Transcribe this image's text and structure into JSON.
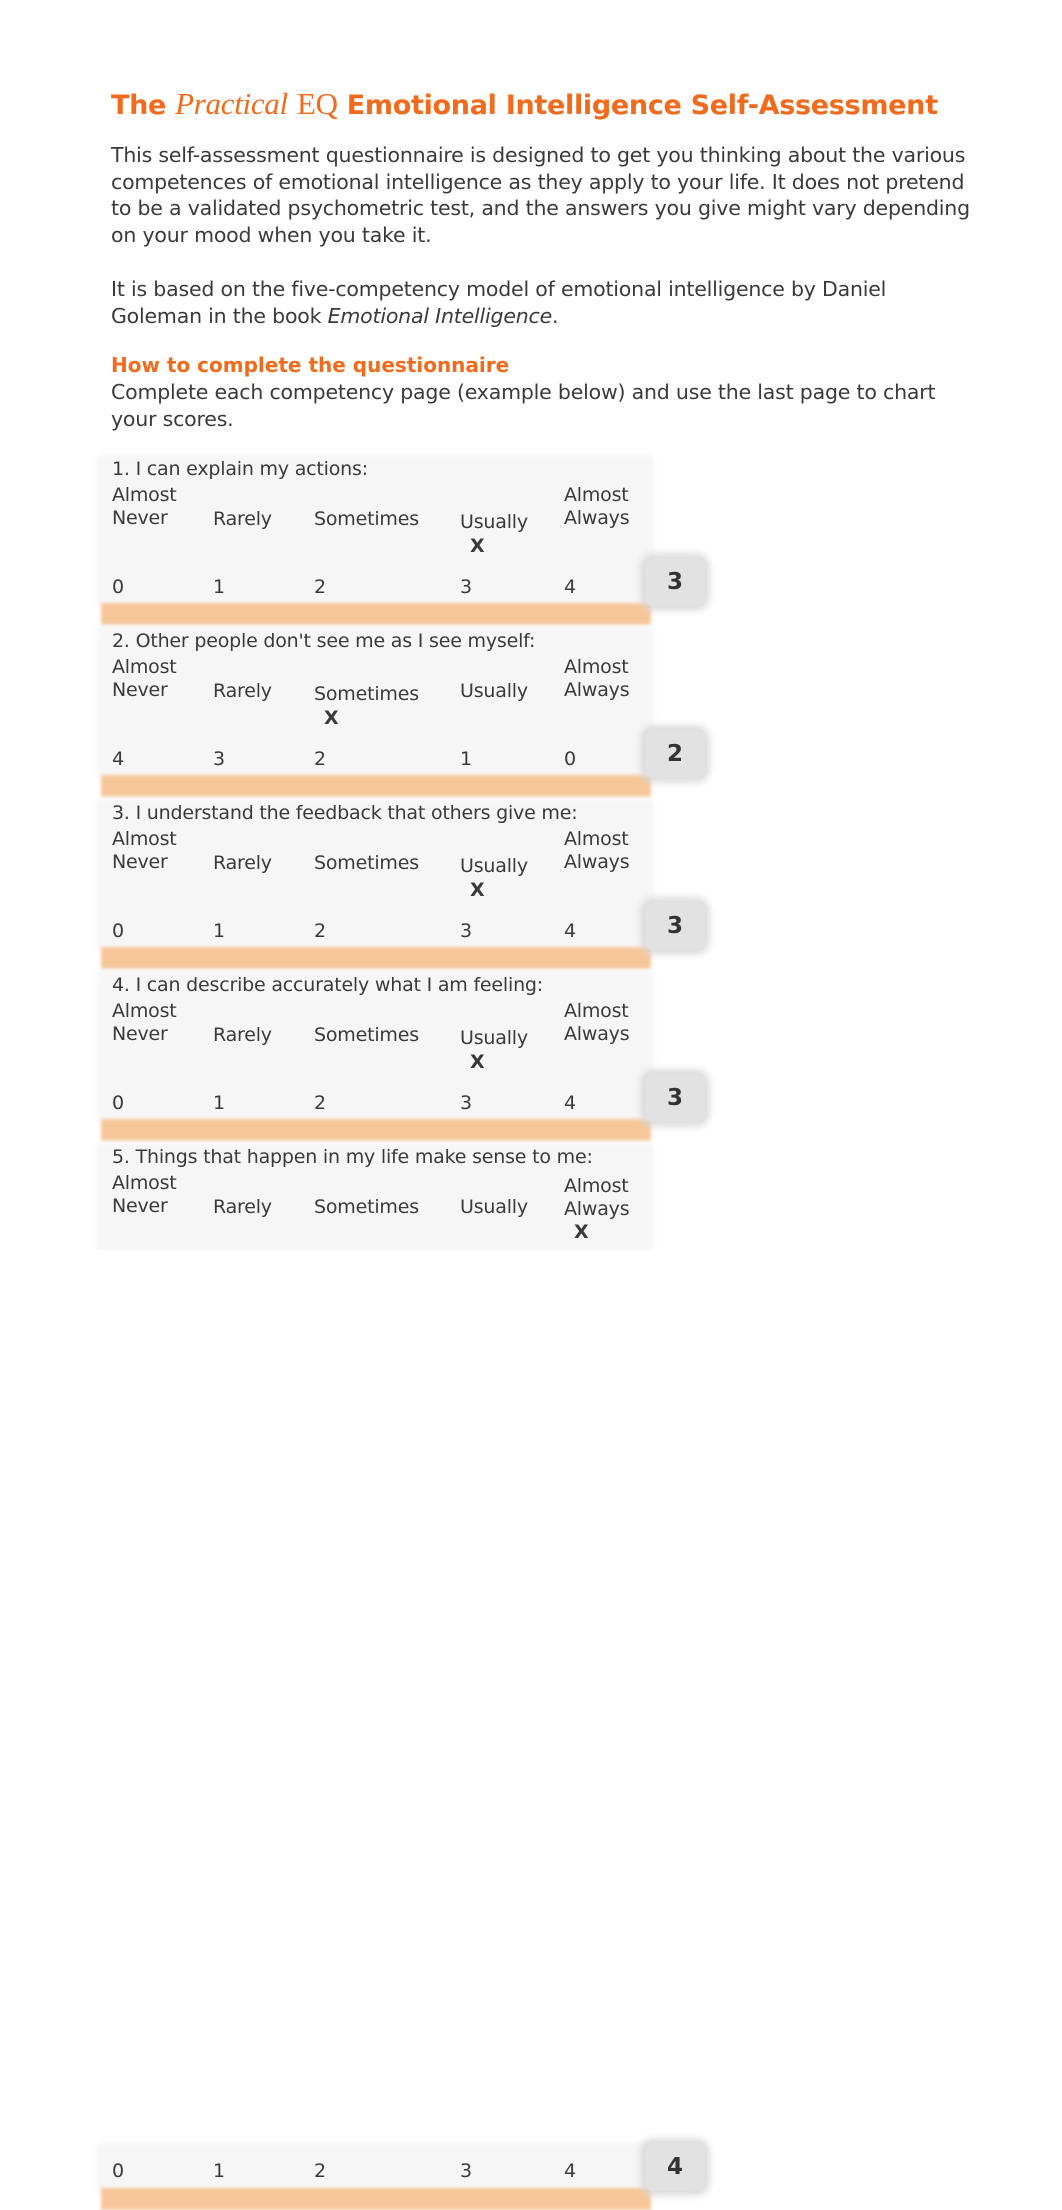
{
  "title": {
    "prefix": "The ",
    "practical": "Practical",
    "eq": "EQ",
    "suffix": " Emotional Intelligence Self-Assessment"
  },
  "intro": "This self-assessment questionnaire is designed to get you thinking about the various competences of emotional intelligence as they apply to your life. It does not pretend to be a validated psychometric test, and the answers you give might vary depending on your mood when you take it.",
  "basis": {
    "text": "It is based on the five-competency model of emotional intelligence by Daniel Goleman in the book ",
    "book": "Emotional Intelligence",
    "end": "."
  },
  "howto": {
    "heading": "How to complete the questionnaire",
    "text": "Complete each competency page (example below) and use the last page to chart your scores."
  },
  "scale_labels": [
    "Almost\nNever",
    "Rarely",
    "Sometimes",
    "Usually",
    "Almost\nAlways"
  ],
  "mark_symbol": "X",
  "accent_color": "#f26b1d",
  "questions": [
    {
      "text": "1. I can explain my actions:",
      "points": [
        "0",
        "1",
        "2",
        "3",
        "4"
      ],
      "selected": 3,
      "score": "3"
    },
    {
      "text": "2. Other people don't see me as I see myself:",
      "points": [
        "4",
        "3",
        "2",
        "1",
        "0"
      ],
      "selected": 2,
      "score": "2"
    },
    {
      "text": "3. I understand the feedback that others give me:",
      "points": [
        "0",
        "1",
        "2",
        "3",
        "4"
      ],
      "selected": 3,
      "score": "3"
    },
    {
      "text": "4. I can describe accurately what I am feeling:",
      "points": [
        "0",
        "1",
        "2",
        "3",
        "4"
      ],
      "selected": 3,
      "score": "3"
    },
    {
      "text": "5. Things that happen in my life make sense to me:",
      "points": [
        "0",
        "1",
        "2",
        "3",
        "4"
      ],
      "selected": 4,
      "score": "4"
    }
  ]
}
